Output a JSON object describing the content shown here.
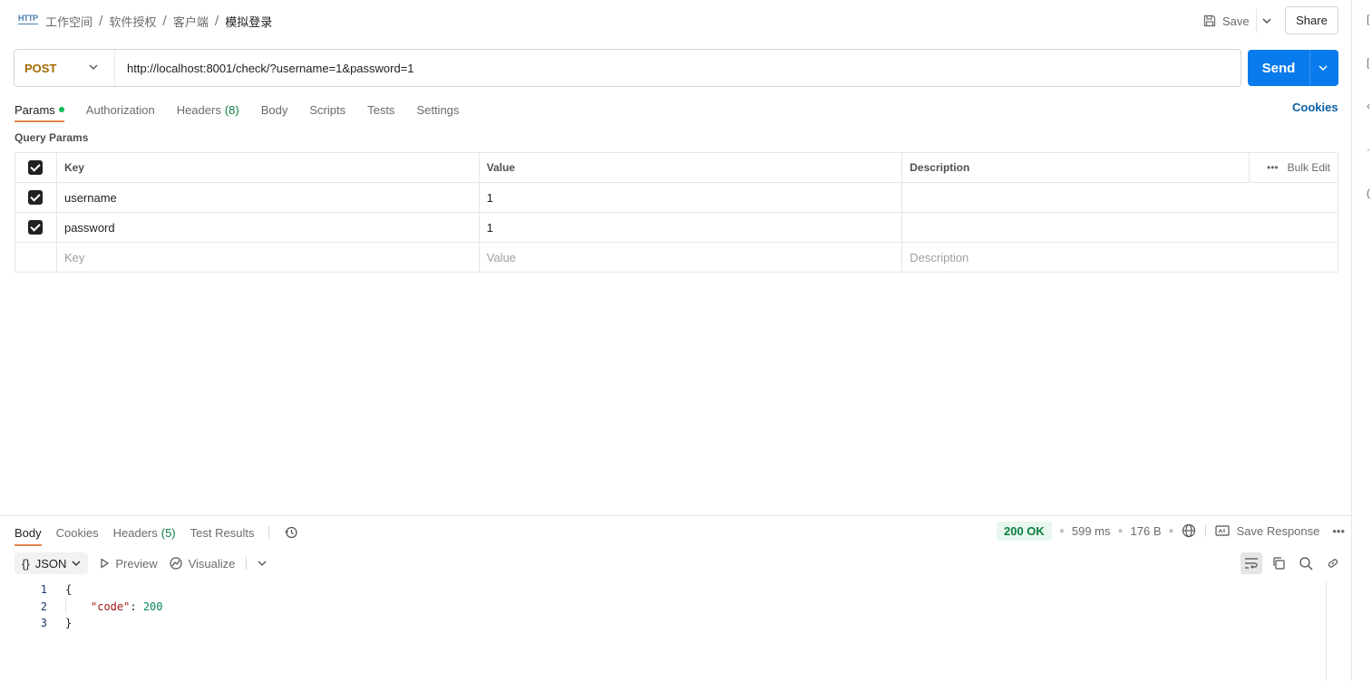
{
  "header": {
    "icon_text": "HTTP",
    "breadcrumb": [
      "工作空间",
      "软件授权",
      "客户端"
    ],
    "current": "模拟登录",
    "save_label": "Save",
    "share_label": "Share"
  },
  "request": {
    "method": "POST",
    "url": "http://localhost:8001/check/?username=1&password=1",
    "send_label": "Send"
  },
  "tabs": {
    "params": "Params",
    "authorization": "Authorization",
    "headers": "Headers",
    "headers_count": "(8)",
    "body": "Body",
    "scripts": "Scripts",
    "tests": "Tests",
    "settings": "Settings",
    "cookies": "Cookies"
  },
  "params": {
    "title": "Query Params",
    "col_key": "Key",
    "col_value": "Value",
    "col_description": "Description",
    "bulk_edit": "Bulk Edit",
    "rows": [
      {
        "key": "username",
        "value": "1",
        "description": ""
      },
      {
        "key": "password",
        "value": "1",
        "description": ""
      }
    ],
    "placeholder_key": "Key",
    "placeholder_value": "Value",
    "placeholder_description": "Description"
  },
  "response": {
    "tabs": {
      "body": "Body",
      "cookies": "Cookies",
      "headers": "Headers",
      "headers_count": "(5)",
      "test_results": "Test Results"
    },
    "status": "200 OK",
    "time": "599 ms",
    "size": "176 B",
    "save_response": "Save Response",
    "format": "JSON",
    "format_icon": "{}",
    "preview": "Preview",
    "visualize": "Visualize",
    "code_lines": {
      "l1": "{",
      "l2_key": "\"code\"",
      "l2_colon": ": ",
      "l2_value": "200",
      "l3": "}"
    },
    "line_numbers": [
      "1",
      "2",
      "3"
    ]
  }
}
